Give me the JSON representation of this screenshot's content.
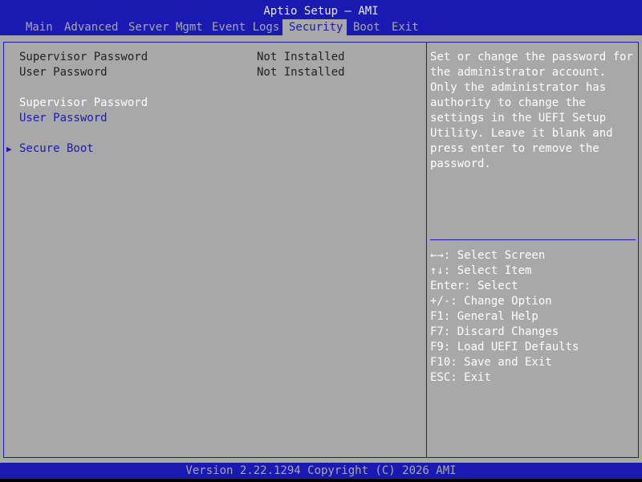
{
  "title": "Aptio Setup – AMI",
  "tabs": [
    "Main",
    "Advanced",
    "Server Mgmt",
    "Event Logs",
    "Security",
    "Boot",
    "Exit"
  ],
  "active_tab": "Security",
  "settings": [
    {
      "label": "Supervisor Password",
      "value": "Not Installed"
    },
    {
      "label": "User Password",
      "value": "Not Installed"
    }
  ],
  "options": [
    {
      "label": "Supervisor Password",
      "selected": true
    },
    {
      "label": "User Password",
      "selected": false
    }
  ],
  "submenu": {
    "label": "Secure Boot",
    "icon": "right-triangle-icon"
  },
  "help_text": [
    "Set or change the password for",
    "the administrator account.",
    "Only the administrator has",
    "authority to change the",
    "settings in the UEFI Setup",
    "Utility. Leave it blank and",
    "press enter to remove the",
    "password."
  ],
  "key_hints": [
    "←→: Select Screen",
    "↑↓: Select Item",
    "Enter: Select",
    "+/-: Change Option",
    "F1: General Help",
    "F7: Discard Changes",
    "F9: Load UEFI Defaults",
    "F10: Save and Exit",
    "ESC: Exit"
  ],
  "footer": "Version 2.22.1294 Copyright (C) 2026 AMI",
  "colors": {
    "blue": "#1a1ab2",
    "gray": "#a8a8a8",
    "white": "#ffffff",
    "dark": "#222222"
  }
}
